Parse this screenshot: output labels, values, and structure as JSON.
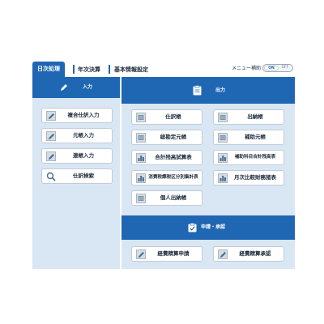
{
  "tabs": [
    {
      "label": "日次処理",
      "active": true
    },
    {
      "label": "年次決算",
      "active": false
    },
    {
      "label": "基本情報設定",
      "active": false
    }
  ],
  "menu_assist": {
    "label": "メニュー補助",
    "on": "ON",
    "off": "OFF"
  },
  "input_panel": {
    "title": "入力",
    "items": [
      {
        "label": "複合仕訳入力",
        "icon": "pencil-icon"
      },
      {
        "label": "元帳入力",
        "icon": "pencil-icon"
      },
      {
        "label": "連帳入力",
        "icon": "pencil-icon"
      },
      {
        "label": "仕訳検索",
        "icon": "magnifier-icon"
      }
    ]
  },
  "output_panel": {
    "title": "出力",
    "items": [
      {
        "label": "仕訳帳",
        "icon": "ledger-icon"
      },
      {
        "label": "出納帳",
        "icon": "ledger-icon"
      },
      {
        "label": "総勘定元帳",
        "icon": "ledger-icon"
      },
      {
        "label": "補助元帳",
        "icon": "ledger-icon"
      },
      {
        "label": "合計残高試算表",
        "icon": "bar-chart-icon"
      },
      {
        "label": "補助科目合計残高表",
        "icon": "bar-chart-icon"
      },
      {
        "label": "消費税課税区分別集計表",
        "icon": "bar-chart-icon"
      },
      {
        "label": "月次比較財務諸表",
        "icon": "bar-chart-icon"
      },
      {
        "label": "個人出納帳",
        "icon": "ledger-icon"
      }
    ]
  },
  "approval_panel": {
    "title": "申請・承認",
    "items": [
      {
        "label": "経費精算申請",
        "icon": "pencil-icon"
      },
      {
        "label": "経費精算承認",
        "icon": "pencil-icon"
      }
    ]
  },
  "colors": {
    "accent": "#1f66b3",
    "panel": "#d9e6f3"
  }
}
